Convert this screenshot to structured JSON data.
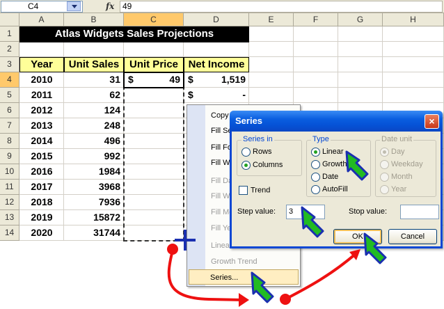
{
  "formula_bar": {
    "name_box": "C4",
    "fx_label": "fx",
    "formula": "49"
  },
  "columns": [
    "A",
    "B",
    "C",
    "D",
    "E",
    "F",
    "G",
    "H"
  ],
  "rows": [
    "1",
    "2",
    "3",
    "4",
    "5",
    "6",
    "7",
    "8",
    "9",
    "10",
    "11",
    "12",
    "13",
    "14"
  ],
  "sheet": {
    "title": "Atlas Widgets Sales Projections",
    "headers": [
      "Year",
      "Unit Sales",
      "Unit Price",
      "Net Income"
    ],
    "data": [
      {
        "year": "2010",
        "units": "31",
        "price_sym": "$",
        "price": "49",
        "inc_sym": "$",
        "income": "1,519"
      },
      {
        "year": "2011",
        "units": "62",
        "price_sym": "",
        "price": "",
        "inc_sym": "$",
        "income": "-"
      },
      {
        "year": "2012",
        "units": "124"
      },
      {
        "year": "2013",
        "units": "248"
      },
      {
        "year": "2014",
        "units": "496"
      },
      {
        "year": "2015",
        "units": "992"
      },
      {
        "year": "2016",
        "units": "1984"
      },
      {
        "year": "2017",
        "units": "3968"
      },
      {
        "year": "2018",
        "units": "7936"
      },
      {
        "year": "2019",
        "units": "15872"
      },
      {
        "year": "2020",
        "units": "31744"
      }
    ]
  },
  "context_menu": {
    "items": [
      {
        "label": "Copy",
        "enabled": true
      },
      {
        "label": "Fill Se",
        "enabled": true
      },
      {
        "label": "Fill Fo",
        "enabled": true
      },
      {
        "label": "Fill Wi",
        "enabled": true
      },
      {
        "label": "Fill Da",
        "enabled": false
      },
      {
        "label": "Fill W",
        "enabled": false
      },
      {
        "label": "Fill Mo",
        "enabled": false
      },
      {
        "label": "Fill Ye",
        "enabled": false
      },
      {
        "label": "Linea",
        "enabled": false
      },
      {
        "label": "Growth Trend",
        "enabled": false
      },
      {
        "label": "Series...",
        "enabled": true
      }
    ]
  },
  "dialog": {
    "title": "Series",
    "close": "×",
    "series_in": {
      "label": "Series in",
      "options": [
        "Rows",
        "Columns"
      ],
      "selected": "Columns"
    },
    "type": {
      "label": "Type",
      "options": [
        "Linear",
        "Growth",
        "Date",
        "AutoFill"
      ],
      "selected": "Linear"
    },
    "date_unit": {
      "label": "Date unit",
      "options": [
        "Day",
        "Weekday",
        "Month",
        "Year"
      ],
      "selected": "Day"
    },
    "trend_label": "Trend",
    "step_label": "Step value:",
    "step_value": "3",
    "stop_label": "Stop value:",
    "stop_value": "",
    "ok_label": "OK",
    "cancel_label": "Cancel"
  },
  "colors": {
    "header_fill": "#ffff99",
    "title_fill": "#000000",
    "arrow_fill": "#22bb22",
    "arrow_outline": "#1a2fb0",
    "connector": "#ee1111"
  }
}
